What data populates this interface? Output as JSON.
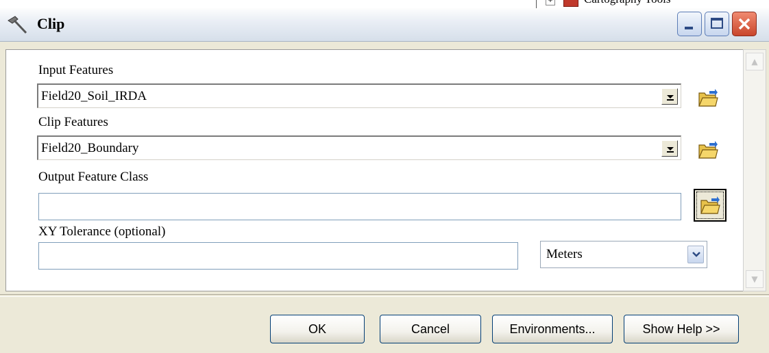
{
  "background": {
    "toolbox_item": "Cartography Tools"
  },
  "window": {
    "title": "Clip",
    "controls": {
      "minimize": "minimize-icon",
      "maximize": "maximize-icon",
      "close": "close-icon"
    }
  },
  "form": {
    "input_features": {
      "label": "Input Features",
      "value": "Field20_Soil_IRDA"
    },
    "clip_features": {
      "label": "Clip Features",
      "value": "Field20_Boundary"
    },
    "output_feature_class": {
      "label": "Output Feature Class",
      "value": ""
    },
    "xy_tolerance": {
      "label": "XY Tolerance (optional)",
      "value": "",
      "units": "Meters"
    }
  },
  "buttons": {
    "ok": "OK",
    "cancel": "Cancel",
    "environments": "Environments...",
    "show_help": "Show Help >>"
  },
  "colors": {
    "close_button": "#c9462c",
    "dialog_bg": "#ece9d8",
    "field_border": "#7f9db9"
  }
}
